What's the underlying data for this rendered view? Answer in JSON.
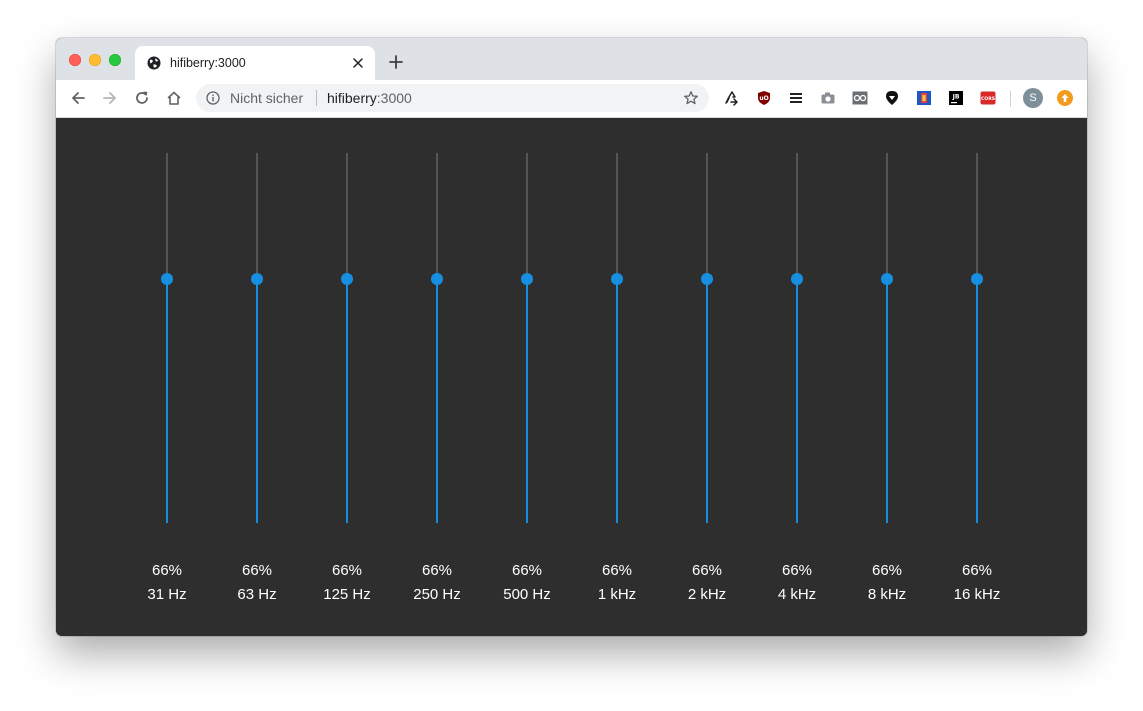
{
  "browser": {
    "tab_title": "hifiberry:3000",
    "address_security": "Nicht sicher",
    "address_host": "hifiberry",
    "address_port": ":3000",
    "avatar_letter": "S",
    "extension_labels": {
      "ublock": "uO",
      "jetbrains": "JB",
      "cors": "CORS"
    }
  },
  "colors": {
    "accent": "#168fe0",
    "track": "#555555",
    "background": "#2e2e2e",
    "text": "#ffffff"
  },
  "equalizer": {
    "bands": [
      {
        "label": "31 Hz",
        "value": 66,
        "display": "66%"
      },
      {
        "label": "63 Hz",
        "value": 66,
        "display": "66%"
      },
      {
        "label": "125 Hz",
        "value": 66,
        "display": "66%"
      },
      {
        "label": "250 Hz",
        "value": 66,
        "display": "66%"
      },
      {
        "label": "500 Hz",
        "value": 66,
        "display": "66%"
      },
      {
        "label": "1 kHz",
        "value": 66,
        "display": "66%"
      },
      {
        "label": "2 kHz",
        "value": 66,
        "display": "66%"
      },
      {
        "label": "4 kHz",
        "value": 66,
        "display": "66%"
      },
      {
        "label": "8 kHz",
        "value": 66,
        "display": "66%"
      },
      {
        "label": "16 kHz",
        "value": 66,
        "display": "66%"
      }
    ]
  }
}
